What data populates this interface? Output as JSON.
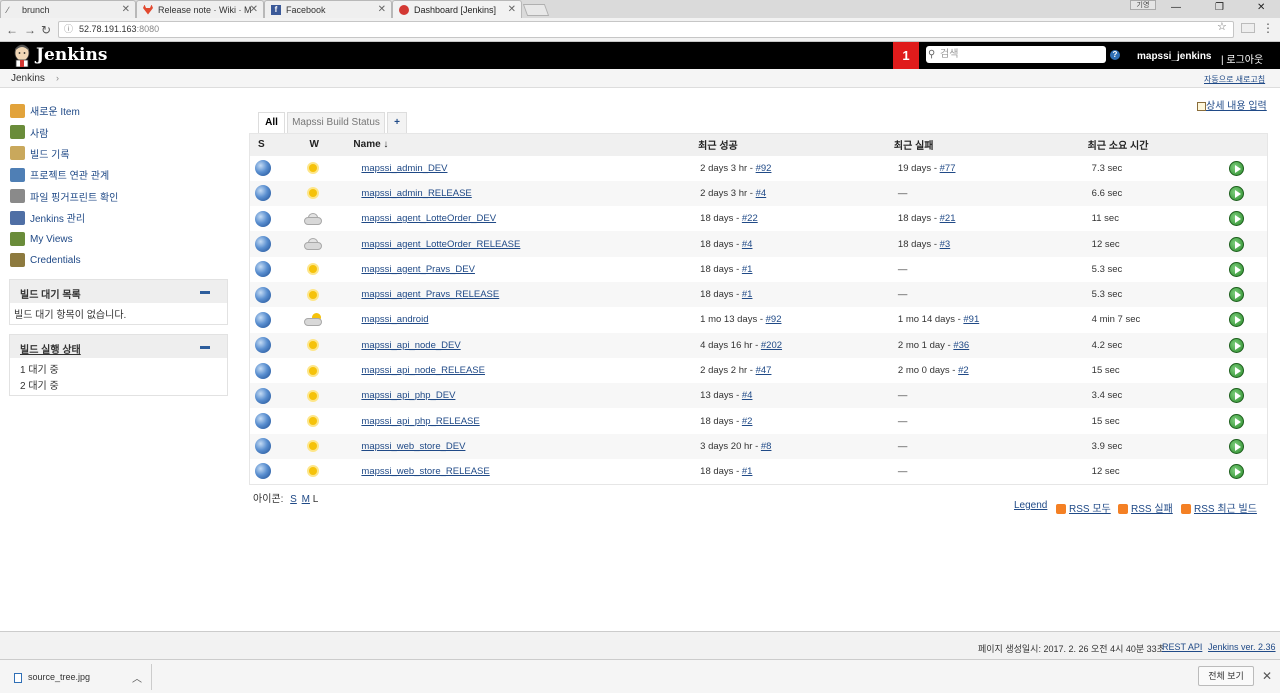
{
  "browser": {
    "tabs": [
      {
        "title": "brunch"
      },
      {
        "title": "Release note · Wiki · M"
      },
      {
        "title": "Facebook"
      },
      {
        "title": "Dashboard [Jenkins]"
      }
    ],
    "profile_label": "기영",
    "url_host": "52.78.191.163",
    "url_port": ":8080"
  },
  "jenkins": {
    "title": "Jenkins",
    "notification_count": "1",
    "search_placeholder": "검색",
    "user": "mapssi_jenkins",
    "logout": "| 로그아웃",
    "breadcrumb": "Jenkins",
    "auto_refresh": "자동으로 새로고침",
    "edit_description": "상세 내용 입력"
  },
  "sidebar": {
    "tasks": [
      {
        "label": "새로운 Item",
        "icon": "new-item-icon",
        "color": "#e2a33b"
      },
      {
        "label": "사람",
        "icon": "people-icon",
        "color": "#6a8c3a"
      },
      {
        "label": "빌드 기록",
        "icon": "build-history-icon",
        "color": "#c9a85c"
      },
      {
        "label": "프로젝트 연관 관계",
        "icon": "search-icon",
        "color": "#4f7fb5"
      },
      {
        "label": "파일 핑거프린트 확인",
        "icon": "fingerprint-icon",
        "color": "#8a8a8a"
      },
      {
        "label": "Jenkins 관리",
        "icon": "gear-icon",
        "color": "#4f6fa5"
      },
      {
        "label": "My Views",
        "icon": "people-icon",
        "color": "#6a8c3a"
      },
      {
        "label": "Credentials",
        "icon": "key-icon",
        "color": "#8d7a3f"
      }
    ],
    "queue_title": "빌드 대기 목록",
    "queue_empty": "빌드 대기 항목이 없습니다.",
    "executor_title": "빌드 실행 상태",
    "executors": [
      "1 대기 중",
      "2 대기 중"
    ]
  },
  "views": {
    "tabs": [
      "All",
      "Mapssi Build Status",
      "+"
    ]
  },
  "table": {
    "headers": {
      "s": "S",
      "w": "W",
      "name": "Name ↓",
      "last_success": "최근 성공",
      "last_failure": "최근 실패",
      "last_duration": "최근 소요 시간"
    },
    "rows": [
      {
        "name": "mapssi_admin_DEV",
        "weather": "sunny",
        "success_text": "2 days 3 hr - ",
        "success_link": "#92",
        "failure_text": "19 days - ",
        "failure_link": "#77",
        "duration": "7.3 sec"
      },
      {
        "name": "mapssi_admin_RELEASE",
        "weather": "sunny",
        "success_text": "2 days 3 hr - ",
        "success_link": "#4",
        "failure_text": "—",
        "failure_link": "",
        "duration": "6.6 sec"
      },
      {
        "name": "mapssi_agent_LotteOrder_DEV",
        "weather": "cloudy",
        "success_text": "18 days - ",
        "success_link": "#22",
        "failure_text": "18 days - ",
        "failure_link": "#21",
        "duration": "11 sec"
      },
      {
        "name": "mapssi_agent_LotteOrder_RELEASE",
        "weather": "cloudy",
        "success_text": "18 days - ",
        "success_link": "#4",
        "failure_text": "18 days - ",
        "failure_link": "#3",
        "duration": "12 sec"
      },
      {
        "name": "mapssi_agent_Pravs_DEV",
        "weather": "sunny",
        "success_text": "18 days - ",
        "success_link": "#1",
        "failure_text": "—",
        "failure_link": "",
        "duration": "5.3 sec"
      },
      {
        "name": "mapssi_agent_Pravs_RELEASE",
        "weather": "sunny",
        "success_text": "18 days - ",
        "success_link": "#1",
        "failure_text": "—",
        "failure_link": "",
        "duration": "5.3 sec"
      },
      {
        "name": "mapssi_android",
        "weather": "partly-cloudy",
        "success_text": "1 mo 13 days - ",
        "success_link": "#92",
        "failure_text": "1 mo 14 days - ",
        "failure_link": "#91",
        "duration": "4 min 7 sec"
      },
      {
        "name": "mapssi_api_node_DEV",
        "weather": "sunny",
        "success_text": "4 days 16 hr - ",
        "success_link": "#202",
        "failure_text": "2 mo 1 day - ",
        "failure_link": "#36",
        "duration": "4.2 sec"
      },
      {
        "name": "mapssi_api_node_RELEASE",
        "weather": "sunny",
        "success_text": "2 days 2 hr - ",
        "success_link": "#47",
        "failure_text": "2 mo 0 days - ",
        "failure_link": "#2",
        "duration": "15 sec"
      },
      {
        "name": "mapssi_api_php_DEV",
        "weather": "sunny",
        "success_text": "13 days - ",
        "success_link": "#4",
        "failure_text": "—",
        "failure_link": "",
        "duration": "3.4 sec"
      },
      {
        "name": "mapssi_api_php_RELEASE",
        "weather": "sunny",
        "success_text": "18 days - ",
        "success_link": "#2",
        "failure_text": "—",
        "failure_link": "",
        "duration": "15 sec"
      },
      {
        "name": "mapssi_web_store_DEV",
        "weather": "sunny",
        "success_text": "3 days 20 hr - ",
        "success_link": "#8",
        "failure_text": "—",
        "failure_link": "",
        "duration": "3.9 sec"
      },
      {
        "name": "mapssi_web_store_RELEASE",
        "weather": "sunny",
        "success_text": "18 days - ",
        "success_link": "#1",
        "failure_text": "—",
        "failure_link": "",
        "duration": "12 sec"
      }
    ]
  },
  "icon_size": {
    "label": "아이콘:",
    "sizes": [
      "S",
      "M",
      "L"
    ]
  },
  "footer_links": {
    "legend": "Legend",
    "rss_all": "RSS 모두",
    "rss_failed": "RSS 실패",
    "rss_latest": "RSS 최근 빌드"
  },
  "page_footer": {
    "generated": "페이지 생성일시: 2017. 2. 26 오전 4시 40분 33초",
    "rest_api": "REST API",
    "version": "Jenkins ver. 2.36"
  },
  "downloads": {
    "file": "source_tree.jpg",
    "show_all": "전체 보기"
  }
}
